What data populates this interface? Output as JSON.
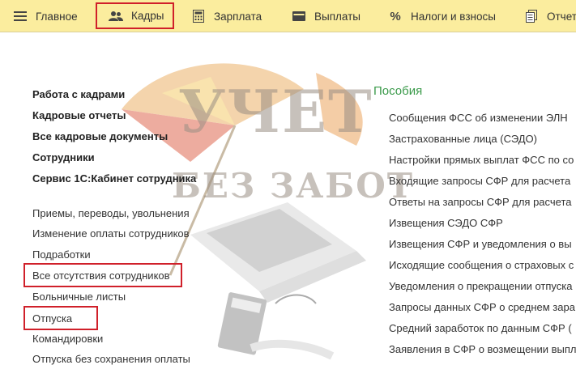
{
  "menu": {
    "items": [
      {
        "label": "Главное",
        "icon": "hamburger-icon"
      },
      {
        "label": "Кадры",
        "icon": "people-icon"
      },
      {
        "label": "Зарплата",
        "icon": "calculator-icon"
      },
      {
        "label": "Выплаты",
        "icon": "wallet-icon"
      },
      {
        "label": "Налоги и взносы",
        "icon": "percent-icon"
      },
      {
        "label": "Отчет",
        "icon": "document-icon"
      }
    ],
    "active_item": "Кадры"
  },
  "left_section": {
    "main_links": [
      "Работа с кадрами",
      "Кадровые отчеты",
      "Все кадровые документы",
      "Сотрудники",
      "Сервис 1С:Кабинет сотрудника"
    ],
    "links": [
      "Приемы, переводы, увольнения",
      "Изменение оплаты сотрудников",
      "Подработки",
      "Все отсутствия сотрудников",
      "Больничные листы",
      "Отпуска",
      "Командировки",
      "Отпуска без сохранения оплаты"
    ]
  },
  "right_section": {
    "title": "Пособия",
    "links": [
      "Сообщения ФСС об изменении ЭЛН",
      "Застрахованные лица (СЭДО)",
      "Настройки прямых выплат ФСС по со",
      "Входящие запросы СФР для расчета",
      "Ответы на запросы СФР для расчета",
      "Извещения СЭДО СФР",
      "Извещения СФР и уведомления о вы",
      "Исходящие сообщения о страховых с",
      "Уведомления о прекращении отпуска",
      "Запросы данных СФР о среднем зара",
      "Средний заработок по данным СФР (",
      "Заявления в СФР о возмещении выпл"
    ]
  },
  "watermark": {
    "line1": "УЧЕТ",
    "line2": "БЕЗ ЗАБОТ"
  },
  "colors": {
    "menu_background": "#fbed9e",
    "highlight_border": "#d0202a",
    "section_title": "#3a9a4a"
  }
}
